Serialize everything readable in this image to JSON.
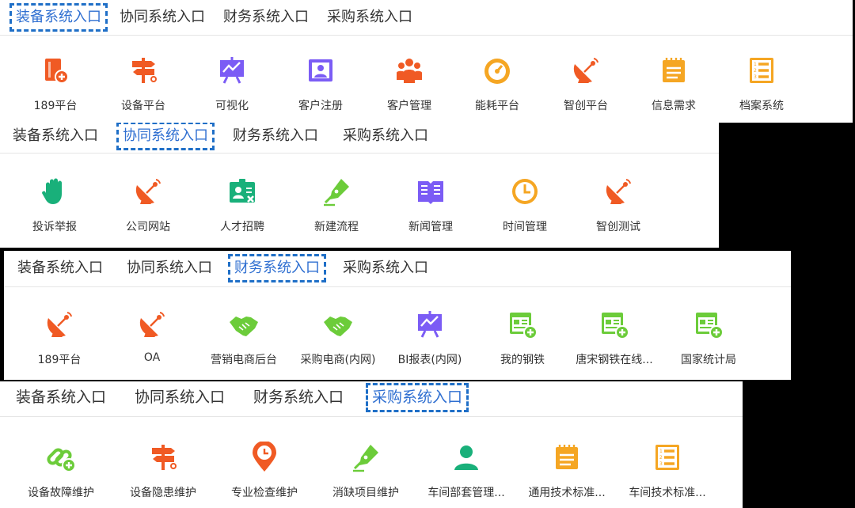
{
  "colors": {
    "active_tab": "#2f6fd1",
    "highlight_border": "#1f6fc7",
    "orange": "#f05a24",
    "purple": "#7b5cf5",
    "amber": "#f5a623",
    "green": "#19b07a",
    "lime": "#6ccc3a"
  },
  "tabs": {
    "equip": "装备系统入口",
    "collab": "协同系统入口",
    "finance": "财务系统入口",
    "purchase": "采购系统入口"
  },
  "panels": {
    "equip": {
      "active": "equip",
      "items": [
        {
          "label": "189平台",
          "icon": "book-plus-icon"
        },
        {
          "label": "设备平台",
          "icon": "signpost-icon"
        },
        {
          "label": "可视化",
          "icon": "presentation-chart-icon"
        },
        {
          "label": "客户注册",
          "icon": "portrait-icon"
        },
        {
          "label": "客户管理",
          "icon": "people-group-icon"
        },
        {
          "label": "能耗平台",
          "icon": "gauge-icon"
        },
        {
          "label": "智创平台",
          "icon": "satellite-dish-icon"
        },
        {
          "label": "信息需求",
          "icon": "notepad-icon"
        },
        {
          "label": "档案系统",
          "icon": "numbered-list-icon"
        }
      ]
    },
    "collab": {
      "active": "collab",
      "items": [
        {
          "label": "投诉举报",
          "icon": "hand-icon"
        },
        {
          "label": "公司网站",
          "icon": "satellite-dish-icon"
        },
        {
          "label": "人才招聘",
          "icon": "id-card-icon"
        },
        {
          "label": "新建流程",
          "icon": "pen-nib-icon"
        },
        {
          "label": "新闻管理",
          "icon": "open-book-icon"
        },
        {
          "label": "时间管理",
          "icon": "clock-icon"
        },
        {
          "label": "智创测试",
          "icon": "satellite-dish-icon"
        }
      ]
    },
    "finance": {
      "active": "finance",
      "items": [
        {
          "label": "189平台",
          "icon": "satellite-dish-icon"
        },
        {
          "label": "OA",
          "icon": "satellite-dish-icon"
        },
        {
          "label": "营销电商后台",
          "icon": "handshake-icon"
        },
        {
          "label": "采购电商(内网)",
          "icon": "handshake-icon"
        },
        {
          "label": "BI报表(内网)",
          "icon": "presentation-chart-icon"
        },
        {
          "label": "我的钢铁",
          "icon": "web-plus-icon"
        },
        {
          "label": "唐宋钢铁在线...",
          "icon": "web-plus-icon"
        },
        {
          "label": "国家统计局",
          "icon": "web-plus-icon"
        }
      ]
    },
    "purchase": {
      "active": "purchase",
      "items": [
        {
          "label": "设备故障维护",
          "icon": "link-plus-icon"
        },
        {
          "label": "设备隐患维护",
          "icon": "signpost-icon"
        },
        {
          "label": "专业检查维护",
          "icon": "location-clock-icon"
        },
        {
          "label": "消缺项目维护",
          "icon": "pen-nib-icon"
        },
        {
          "label": "车间部套管理...",
          "icon": "person-icon"
        },
        {
          "label": "通用技术标准...",
          "icon": "notepad-icon"
        },
        {
          "label": "车间技术标准...",
          "icon": "numbered-list-icon"
        }
      ]
    }
  }
}
